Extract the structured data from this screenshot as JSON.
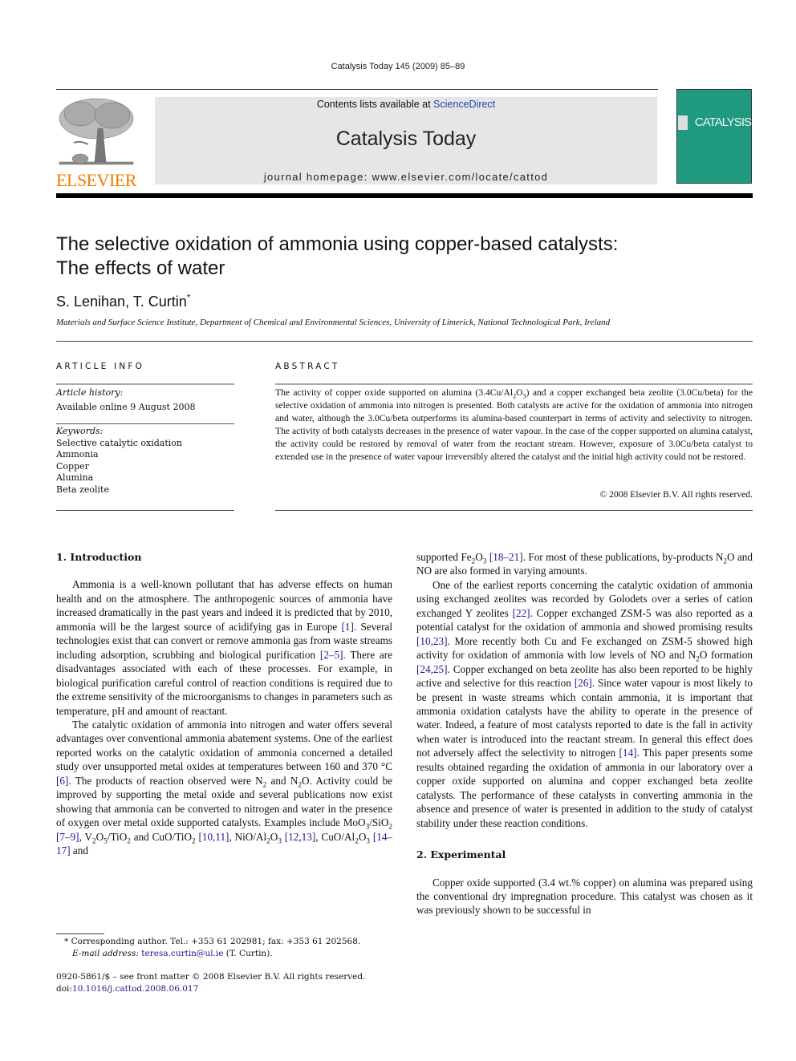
{
  "running_head": "Catalysis Today 145 (2009) 85–89",
  "publisher": {
    "logo_text": "ELSEVIER",
    "logo_color": "#f07d00",
    "logo_icon": "tree-icon"
  },
  "banner": {
    "contents_prefix": "Contents lists available at ",
    "contents_link": "ScienceDirect",
    "journal_title": "Catalysis Today",
    "homepage": "journal homepage: www.elsevier.com/locate/cattod"
  },
  "cover": {
    "text": "CATALYSIS",
    "color": "#1f9a80"
  },
  "article": {
    "title_line1": "The selective oxidation of ammonia using copper-based catalysts:",
    "title_line2": "The effects of water",
    "authors": "S. Lenihan, T. Curtin",
    "author_mark": "*",
    "affiliation": "Materials and Surface Science Institute, Department of Chemical and Environmental Sciences, University of Limerick, National Technological Park, Ireland"
  },
  "article_info": {
    "heading": "ARTICLE INFO",
    "history_label": "Article history:",
    "history_value": "Available online 9 August 2008",
    "keywords_label": "Keywords:",
    "keywords": [
      "Selective catalytic oxidation",
      "Ammonia",
      "Copper",
      "Alumina",
      "Beta zeolite"
    ]
  },
  "abstract": {
    "heading": "ABSTRACT",
    "text_html": "The activity of copper oxide supported on alumina (3.4Cu/Al<sub>2</sub>O<sub>3</sub>) and a copper exchanged beta zeolite (3.0Cu/beta) for the selective oxidation of ammonia into nitrogen is presented. Both catalysts are active for the oxidation of ammonia into nitrogen and water, although the 3.0Cu/beta outperforms its alumina-based counterpart in terms of activity and selectivity to nitrogen. The activity of both catalysts decreases in the presence of water vapour. In the case of the copper supported on alumina catalyst, the activity could be restored by removal of water from the reactant stream. However, exposure of 3.0Cu/beta catalyst to extended use in the presence of water vapour irreversibly altered the catalyst and the initial high activity could not be restored.",
    "copyright": "© 2008 Elsevier B.V. All rights reserved."
  },
  "body": {
    "sec1_heading": "1.  Introduction",
    "left_paragraphs": [
      "Ammonia is a well-known pollutant that has adverse effects on human health and on the atmosphere. The anthropogenic sources of ammonia have increased dramatically in the past years and indeed it is predicted that by 2010, ammonia will be the largest source of acidifying gas in Europe <span class=\"link\">[1]</span>. Several technologies exist that can convert or remove ammonia gas from waste streams including adsorption, scrubbing and biological purification <span class=\"link\">[2–5]</span>. There are disadvantages associated with each of these processes. For example, in biological purification careful control of reaction conditions is required due to the extreme sensitivity of the microorganisms to changes in parameters such as temperature, pH and amount of reactant.",
      "The catalytic oxidation of ammonia into nitrogen and water offers several advantages over conventional ammonia abatement systems. One of the earliest reported works on the catalytic oxidation of ammonia concerned a detailed study over unsupported metal oxides at temperatures between 160 and 370 °C <span class=\"link\">[6]</span>. The products of reaction observed were N<sub>2</sub> and N<sub>2</sub>O. Activity could be improved by supporting the metal oxide and several publications now exist showing that ammonia can be converted to nitrogen and water in the presence of oxygen over metal oxide supported catalysts. Examples include MoO<sub>3</sub>/SiO<sub>2</sub> <span class=\"link\">[7–9]</span>, V<sub>2</sub>O<sub>5</sub>/TiO<sub>2</sub> and CuO/TiO<sub>2</sub> <span class=\"link\">[10,11]</span>, NiO/Al<sub>2</sub>O<sub>3</sub> <span class=\"link\">[12,13]</span>, CuO/Al<sub>2</sub>O<sub>3</sub> <span class=\"link\">[14–17]</span> and"
    ],
    "right_paragraphs": [
      "supported Fe<sub>2</sub>O<sub>3</sub> <span class=\"link\">[18–21]</span>. For most of these publications, by-products N<sub>2</sub>O and NO are also formed in varying amounts.",
      "One of the earliest reports concerning the catalytic oxidation of ammonia using exchanged zeolites was recorded by Golodets over a series of cation exchanged Y zeolites <span class=\"link\">[22]</span>. Copper exchanged ZSM-5 was also reported as a potential catalyst for the oxidation of ammonia and showed promising results <span class=\"link\">[10,23]</span>. More recently both Cu and Fe exchanged on ZSM-5 showed high activity for oxidation of ammonia with low levels of NO and N<sub>2</sub>O formation <span class=\"link\">[24,25]</span>. Copper exchanged on beta zeolite has also been reported to be highly active and selective for this reaction <span class=\"link\">[26]</span>. Since water vapour is most likely to be present in waste streams which contain ammonia, it is important that ammonia oxidation catalysts have the ability to operate in the presence of water. Indeed, a feature of most catalysts reported to date is the fall in activity when water is introduced into the reactant stream. In general this effect does not adversely affect the selectivity to nitrogen <span class=\"link\">[14]</span>. This paper presents some results obtained regarding the oxidation of ammonia in our laboratory over a copper oxide supported on alumina and copper exchanged beta zeolite catalysts. The performance of these catalysts in converting ammonia in the absence and presence of water is presented in addition to the study of catalyst stability under these reaction conditions."
    ],
    "sec2_heading": "2.  Experimental",
    "sec2_paragraph": "Copper oxide supported (3.4 wt.% copper) on alumina was prepared using the conventional dry impregnation procedure. This catalyst was chosen as it was previously shown to be successful in"
  },
  "footnotes": {
    "corresponding": "Corresponding author. Tel.: +353 61 202981; fax: +353 61 202568.",
    "email_label": "E-mail address:",
    "email": "teresa.curtin@ul.ie",
    "email_suffix": " (T. Curtin).",
    "front_matter": "0920-5861/$ – see front matter © 2008 Elsevier B.V. All rights reserved.",
    "doi_prefix": "doi:",
    "doi": "10.1016/j.cattod.2008.06.017"
  }
}
